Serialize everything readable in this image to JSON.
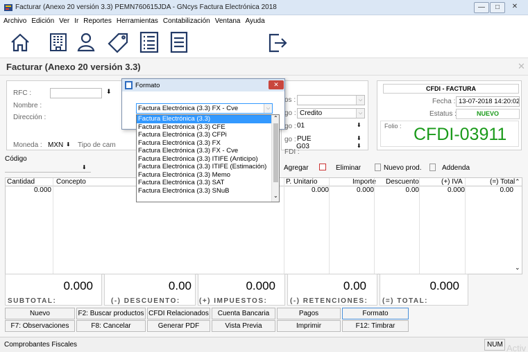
{
  "window": {
    "title": "Facturar (Anexo 20 versión 3.3) PEMN760615JDA - GNcys Factura Electrónica 2018",
    "minimize": "—",
    "maximize": "□",
    "close": "✕"
  },
  "menu": [
    "Archivo",
    "Edición",
    "Ver",
    "Ir",
    "Reportes",
    "Herramientas",
    "Contabilización",
    "Ventana",
    "Ayuda"
  ],
  "toolbar_icons": [
    "home-icon",
    "building-icon",
    "user-icon",
    "tag-icon",
    "list-icon",
    "document-icon",
    "exit-icon"
  ],
  "page_title": "Facturar (Anexo 20 versión 3.3)",
  "client": {
    "rfc_label": "RFC :",
    "nombre_label": "Nombre :",
    "direccion_label": "Dirección :",
    "moneda_label": "Moneda :",
    "moneda_value": "MXN",
    "tipo_label": "Tipo de cam"
  },
  "middle": {
    "row1_label": "os :",
    "row1_value": "",
    "row2_label": "go :",
    "row2_value": "Credito",
    "row3_label": "go :",
    "row3_value": "01",
    "row4_label": "go :",
    "row4_value": "PUE",
    "row5_label": "FDI :",
    "row5_value": "G03"
  },
  "cfdi": {
    "heading": "CFDI - FACTURA",
    "fecha_label": "Fecha :",
    "fecha_value": "13-07-2018 14:20:02",
    "estatus_label": "Estatus :",
    "estatus_value": "NUEVO",
    "folio_label": "Folio :",
    "folio_value": "CFDI-03911",
    "accent": "#1a9a1a"
  },
  "codigo_label": "Código",
  "actions": {
    "agregar": "Agregar",
    "eliminar": "Eliminar",
    "nuevo_prod": "Nuevo prod.",
    "addenda": "Addenda"
  },
  "grid": {
    "headers": {
      "cantidad": "Cantidad",
      "concepto": "Concepto",
      "punitario": "P. Unitario",
      "importe": "Importe",
      "descuento": "Descuento",
      "iva": "(+) IVA",
      "total": "(=) Total"
    },
    "row": {
      "cantidad": "0.000",
      "punitario": "0.000",
      "importe": "0.000",
      "descuento": "0.00",
      "iva": "0.000",
      "total": "0.00"
    }
  },
  "totals": {
    "subtotal_value": "0.000",
    "subtotal_label": "SUBTOTAL:",
    "descuento_value": "0.00",
    "descuento_label": "(-) DESCUENTO:",
    "impuestos_value": "0.000",
    "impuestos_label": "(+) IMPUESTOS:",
    "retenciones_value": "0.00",
    "retenciones_label": "(-) RETENCIONES:",
    "total_value": "0.000",
    "total_label": "(=) TOTAL:"
  },
  "buttons_row1": [
    "Nuevo",
    "F2: Buscar productos",
    "CFDI Relacionados",
    "Cuenta Bancaria",
    "Pagos",
    "Formato"
  ],
  "buttons_row2": [
    "F7: Observaciones",
    "F8: Cancelar",
    "Generar PDF",
    "Vista Previa",
    "Imprimir",
    "F12: Timbrar"
  ],
  "status": {
    "left": "Comprobantes Fiscales",
    "num": "NUM",
    "watermark": "Activ"
  },
  "modal": {
    "title": "Formato",
    "close": "✕",
    "selected": "Factura Electrónica (3.3) FX - Cve",
    "options": [
      "Factura Electrónica (3.3)",
      "Factura Electrónica (3.3) CFE",
      "Factura Electrónica (3.3) CFPi",
      "Factura Electrónica (3.3) FX",
      "Factura Electrónica (3.3) FX - Cve",
      "Factura Electrónica (3.3) ITIFE (Anticipo)",
      "Factura Electrónica (3.3) ITIFE (Estimación)",
      "Factura Electrónica (3.3) Memo",
      "Factura Electrónica (3.3) SAT",
      "Factura Electrónica (3.3) SNuB"
    ]
  }
}
